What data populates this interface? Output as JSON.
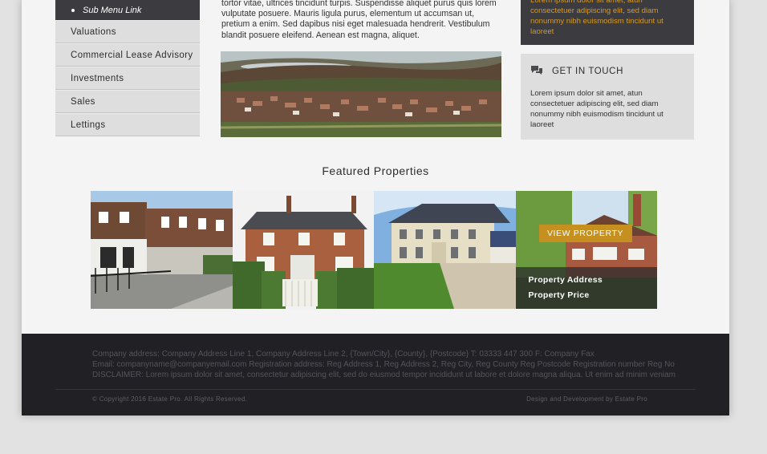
{
  "sidebar": {
    "sub_menu_link": "Sub Menu Link",
    "items": [
      {
        "label": "Valuations"
      },
      {
        "label": "Commercial Lease Advisory"
      },
      {
        "label": "Investments"
      },
      {
        "label": "Sales"
      },
      {
        "label": "Lettings"
      }
    ]
  },
  "main": {
    "body_text": "tortor vitae, ultrices tincidunt turpis. Suspendisse aliquet purus quis lorem vulputate posuere. Mauris ligula purus, elementum ut accumsan ut, pretium a enim. Sed dapibus nisi eget malesuada hendrerit. Vestibulum blandit posuere eleifend. Aenean est magna, aliquet."
  },
  "right": {
    "dark_text": "Lorem ipsum dolor sit amet, atun consectetuer adipiscing elit, sed diam nonummy nibh euismodism tincidunt ut laoreet",
    "get_in_touch_title": "GET IN TOUCH",
    "get_in_touch_text": "Lorem ipsum dolor sit amet, atun consectetuer adipiscing elit, sed diam nonummy nibh euismodism tincidunt ut laoreet"
  },
  "featured": {
    "title": "Featured Properties",
    "view_button": "VIEW PROPERTY",
    "address": "Property Address",
    "price": "Property Price"
  },
  "footer": {
    "address_line": "Company address:  Company Address Line 1, Company Address Line 2, {Town/City}, {County}, {Postcode} T: 03333 447 300 F: Company Fax",
    "email_line": "Email: companyname@companyemail.com  Registration address: Reg Address 1, Reg Address 2, Reg City, Reg County Reg Postcode  Registration number Reg No",
    "disclaimer_line": "DISCLAIMER: Lorem ipsum dolor sit amet, consectetur adipiscing elit, sed do eiusmod tempor incididunt ut labore et dolore magna aliqua. Ut enim ad minim veniam",
    "copyright": "© Copyright 2016 Estate Pro. All Rights Reserved.",
    "credit": "Design and Development by Estate Pro"
  },
  "colors": {
    "dark_panel": "#3b3b40",
    "accent_orange": "#c5901f",
    "footer_bg": "#202025"
  },
  "icons": {
    "get_in_touch": "chat-bubbles-icon"
  }
}
